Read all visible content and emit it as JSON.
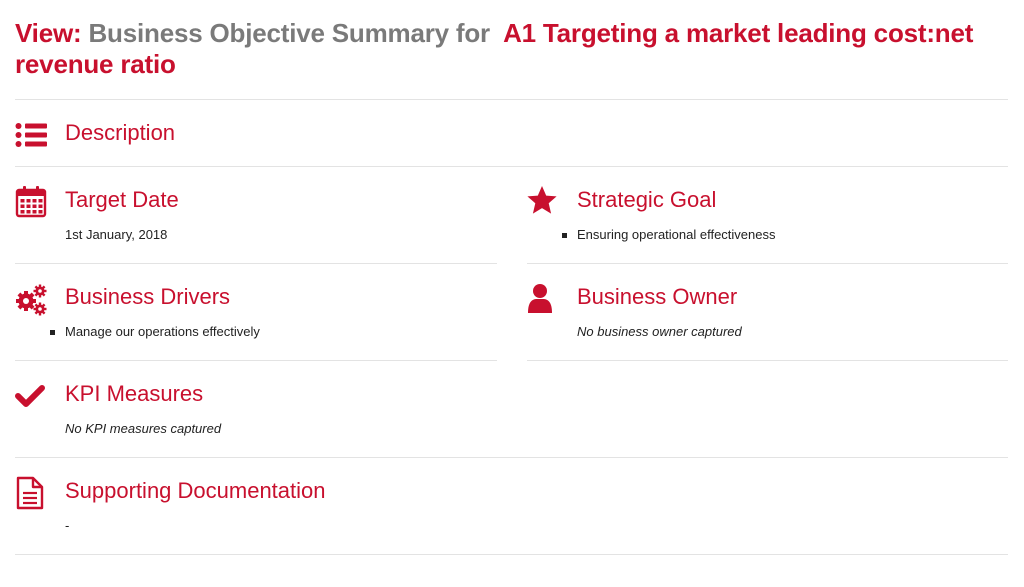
{
  "page": {
    "title_prefix": "View:",
    "title_middle": "Business Objective Summary for",
    "title_subject": "A1 Targeting a market leading cost:net revenue ratio"
  },
  "sections": {
    "description": {
      "heading": "Description",
      "icon": "list-icon"
    },
    "target_date": {
      "heading": "Target Date",
      "icon": "calendar-icon",
      "value": "1st January, 2018"
    },
    "strategic_goal": {
      "heading": "Strategic Goal",
      "icon": "star-icon",
      "items": [
        "Ensuring operational effectiveness"
      ]
    },
    "business_drivers": {
      "heading": "Business Drivers",
      "icon": "gears-icon",
      "items": [
        "Manage our operations effectively"
      ]
    },
    "business_owner": {
      "heading": "Business Owner",
      "icon": "user-icon",
      "value": "No business owner captured"
    },
    "kpi_measures": {
      "heading": "KPI Measures",
      "icon": "checkmark-icon",
      "value": "No KPI measures captured"
    },
    "supporting_documentation": {
      "heading": "Supporting Documentation",
      "icon": "document-icon",
      "value": "-"
    }
  },
  "colors": {
    "accent": "#c8102e",
    "title_grey": "#7a7a7a",
    "rule": "#e3e3e3",
    "text": "#222222"
  }
}
